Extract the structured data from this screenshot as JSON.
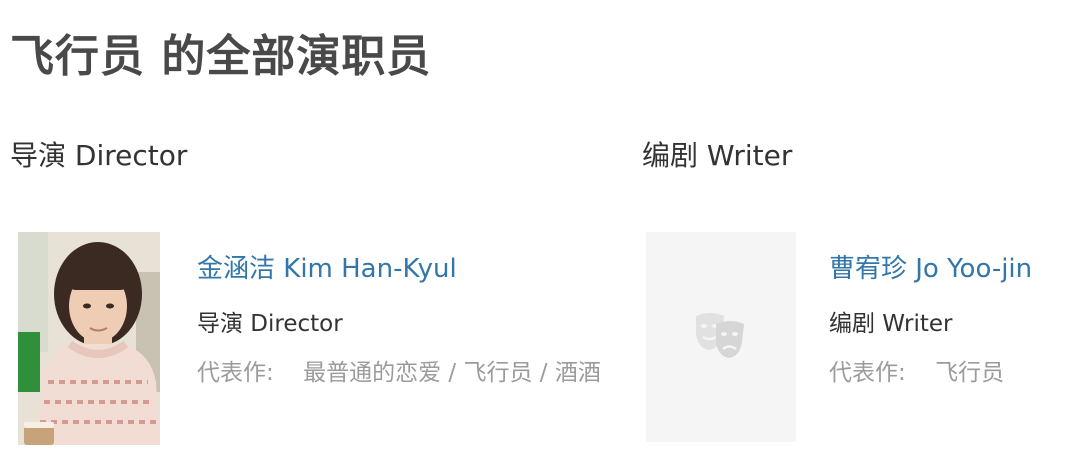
{
  "page": {
    "title": "飞行员 的全部演职员"
  },
  "sections": {
    "director": {
      "heading": "导演 Director"
    },
    "writer": {
      "heading": "编剧 Writer"
    }
  },
  "people": [
    {
      "name": "金涵洁 Kim Han-Kyul",
      "role": "导演 Director",
      "works_label": "代表作:",
      "works": [
        "最普通的恋爱",
        "飞行员",
        "酒酒"
      ],
      "separator": " / "
    },
    {
      "name": "曹宥珍 Jo Yoo-jin",
      "role": "编剧 Writer",
      "works_label": "代表作:",
      "works": [
        "飞行员"
      ],
      "placeholder_icon": "theater-masks-icon"
    }
  ],
  "colors": {
    "link": "#3377aa",
    "muted": "#9b9b9b",
    "title": "#494949",
    "placeholder_bg": "#f5f5f5"
  }
}
